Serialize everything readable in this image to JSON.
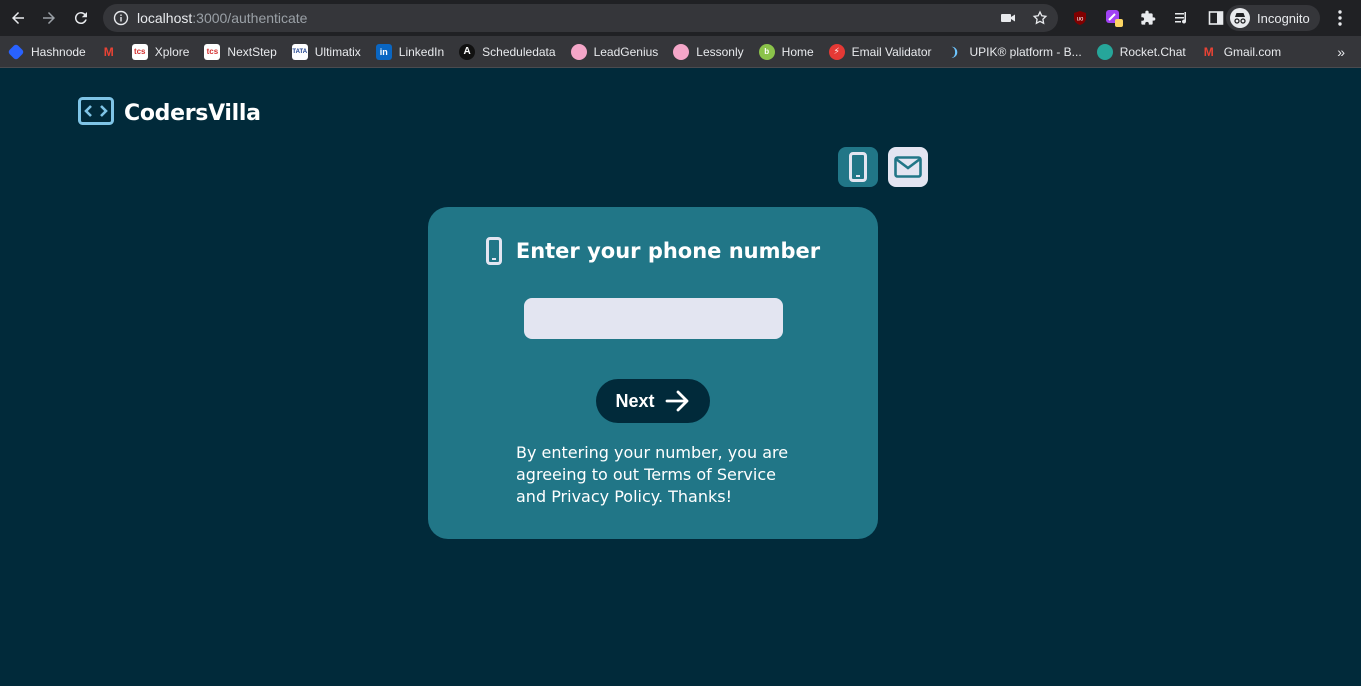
{
  "browser": {
    "url_host": "localhost",
    "url_path": ":3000/authenticate",
    "profile_label": "Incognito",
    "bookmarks": [
      {
        "label": "Hashnode",
        "icon": "hashnode-icon",
        "color": "#2962ff"
      },
      {
        "label": "",
        "icon": "gmail-icon",
        "color": "#ea4335"
      },
      {
        "label": "Xplore",
        "icon": "tcs-icon",
        "color": "#ffffff"
      },
      {
        "label": "NextStep",
        "icon": "tcs-icon",
        "color": "#ffffff"
      },
      {
        "label": "Ultimatix",
        "icon": "tata-icon",
        "color": "#ffffff"
      },
      {
        "label": "LinkedIn",
        "icon": "linkedin-icon",
        "color": "#0a66c2"
      },
      {
        "label": "Scheduledata",
        "icon": "scheduledata-icon",
        "color": "#111111"
      },
      {
        "label": "LeadGenius",
        "icon": "brain-icon",
        "color": "#f4a6c8"
      },
      {
        "label": "Lessonly",
        "icon": "brain-icon",
        "color": "#f4a6c8"
      },
      {
        "label": "Home",
        "icon": "home-icon",
        "color": "#8bc34a"
      },
      {
        "label": "Email Validator",
        "icon": "bolt-icon",
        "color": "#e53935"
      },
      {
        "label": "UPIK® platform - B...",
        "icon": "upik-icon",
        "color": "#35363a"
      },
      {
        "label": "Rocket.Chat",
        "icon": "rocketchat-icon",
        "color": "#26a69a"
      },
      {
        "label": "Gmail.com",
        "icon": "gmail-icon",
        "color": "#ea4335"
      }
    ],
    "more_bookmarks": "»"
  },
  "app": {
    "brand_name": "CodersVilla",
    "colors": {
      "background": "#012a3a",
      "card": "#217687",
      "input": "#e3e5f1",
      "accent_dark": "#012a3a"
    }
  },
  "auth": {
    "title": "Enter your phone number",
    "phone_placeholder": "",
    "next_label": "Next",
    "terms_text": "By entering your number, you are agreeing to out Terms of Service and Privacy Policy. Thanks!"
  }
}
